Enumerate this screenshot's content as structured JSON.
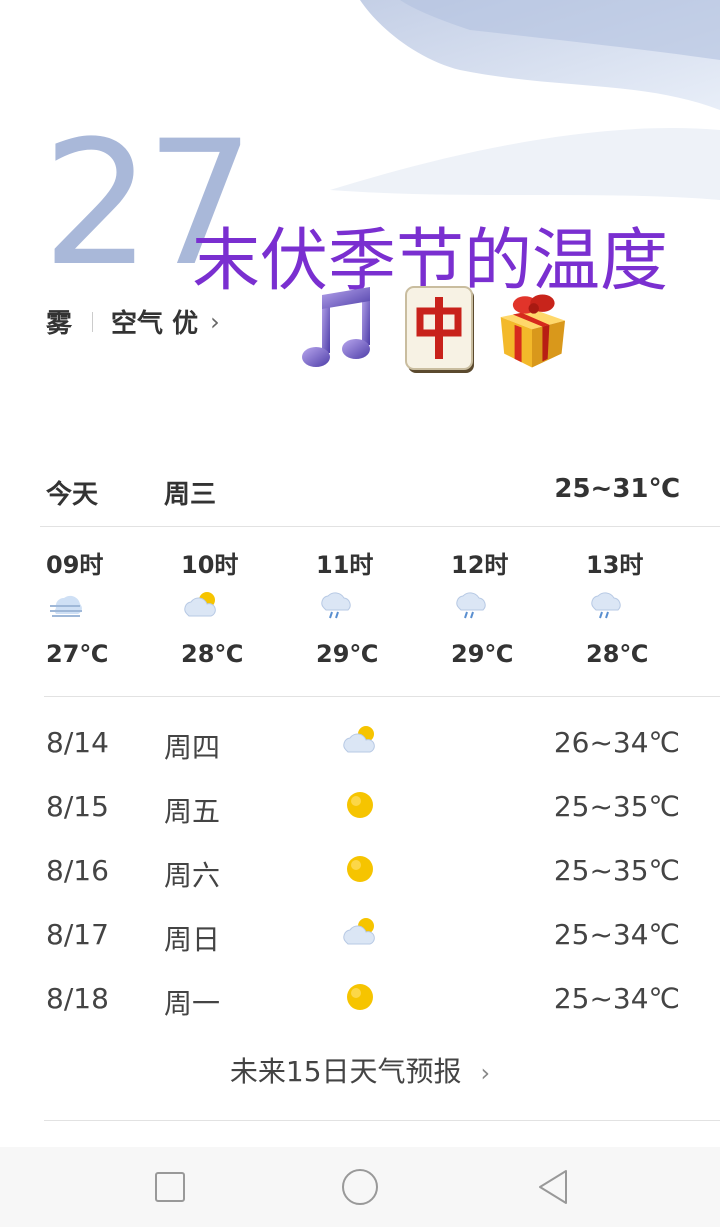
{
  "current": {
    "temperature": "27",
    "condition": "雾",
    "air_quality_label": "空气 优",
    "air_quality_chevron": "›"
  },
  "overlay": {
    "text": "末伏季节的温度",
    "color": "#7a2fd0",
    "emojis": [
      "music-note",
      "mahjong-red-dragon",
      "wrapped-gift"
    ]
  },
  "today": {
    "label": "今天",
    "weekday": "周三",
    "range": "25~31℃"
  },
  "hourly": [
    {
      "hour": "09时",
      "icon": "fog-icon",
      "temp": "27℃"
    },
    {
      "hour": "10时",
      "icon": "partly-cloudy-icon",
      "temp": "28℃"
    },
    {
      "hour": "11时",
      "icon": "rain-icon",
      "temp": "29℃"
    },
    {
      "hour": "12时",
      "icon": "rain-icon",
      "temp": "29℃"
    },
    {
      "hour": "13时",
      "icon": "rain-icon",
      "temp": "28℃"
    }
  ],
  "daily": [
    {
      "date": "8/14",
      "weekday": "周四",
      "icon": "partly-cloudy-icon",
      "range": "26~34℃"
    },
    {
      "date": "8/15",
      "weekday": "周五",
      "icon": "sun-icon",
      "range": "25~35℃"
    },
    {
      "date": "8/16",
      "weekday": "周六",
      "icon": "sun-icon",
      "range": "25~35℃"
    },
    {
      "date": "8/17",
      "weekday": "周日",
      "icon": "partly-cloudy-icon",
      "range": "25~34℃"
    },
    {
      "date": "8/18",
      "weekday": "周一",
      "icon": "sun-icon",
      "range": "25~34℃"
    }
  ],
  "forecast_link": {
    "label": "未来15日天气预报",
    "chevron": "›"
  },
  "navbar": {
    "buttons": [
      "recent-apps",
      "home",
      "back"
    ]
  },
  "colors": {
    "temperature_big": "#a9b8d9",
    "sun": "#f6c400",
    "cloud": "#dbe6f5"
  }
}
